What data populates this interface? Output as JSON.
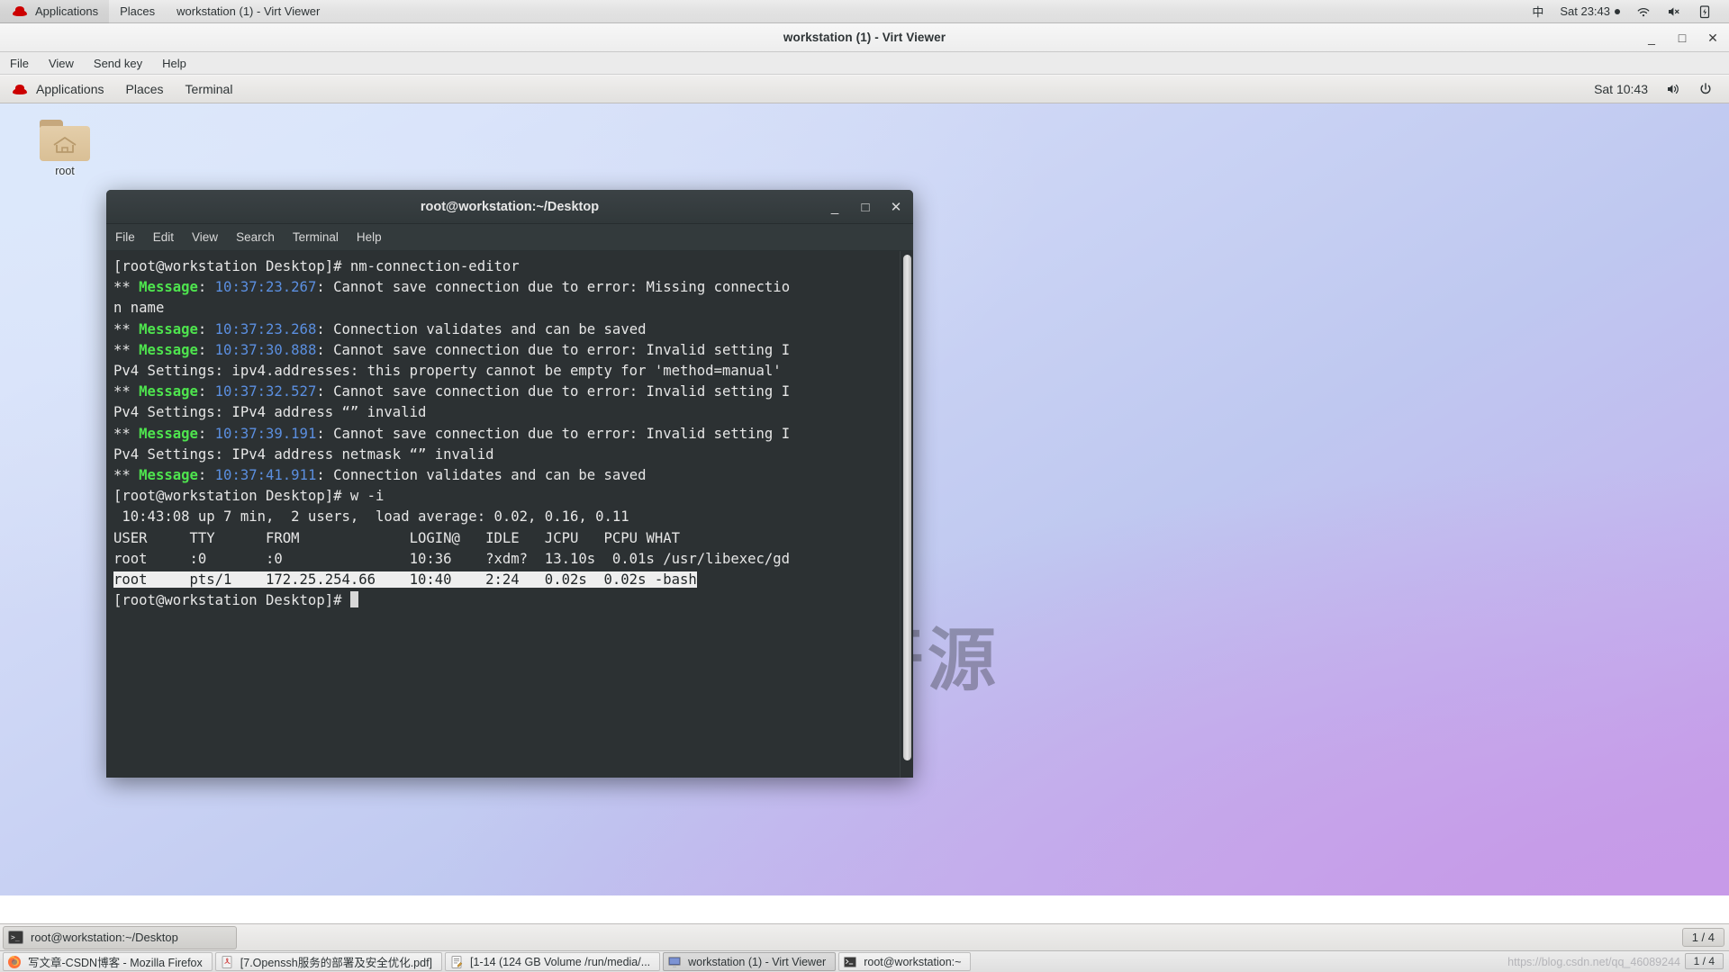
{
  "host_panel": {
    "applications": "Applications",
    "places": "Places",
    "active_window": "workstation (1) - Virt Viewer",
    "input_method": "中",
    "clock": "Sat 23:43",
    "wifi_icon": "wifi-icon",
    "volume_icon": "volume-muted-icon",
    "battery_icon": "battery-charging-icon"
  },
  "virt_viewer": {
    "title": "workstation (1) - Virt Viewer",
    "menus": [
      "File",
      "View",
      "Send key",
      "Help"
    ],
    "window_buttons": {
      "minimize": "_",
      "maximize": "□",
      "close": "✕"
    }
  },
  "guest_panel": {
    "applications": "Applications",
    "places": "Places",
    "active_app": "Terminal",
    "clock": "Sat 10:43",
    "volume_icon": "volume-icon",
    "power_icon": "power-icon"
  },
  "desktop": {
    "icon_label": "root",
    "icon_name": "home-folder-icon",
    "watermark": "西部开源"
  },
  "terminal": {
    "title": "root@workstation:~/Desktop",
    "menus": [
      "File",
      "Edit",
      "View",
      "Search",
      "Terminal",
      "Help"
    ],
    "window_buttons": {
      "minimize": "_",
      "maximize": "□",
      "close": "✕"
    },
    "prompt": "[root@workstation Desktop]# ",
    "lines": [
      {
        "type": "prompt",
        "prompt": "[root@workstation Desktop]# ",
        "command": "nm-connection-editor"
      },
      {
        "type": "message",
        "prefix": "** ",
        "tag": "Message",
        "sep": ": ",
        "time": "10:37:23.267",
        "text": ": Cannot save connection due to error: Missing connectio"
      },
      {
        "type": "plain",
        "text": "n name"
      },
      {
        "type": "message",
        "prefix": "** ",
        "tag": "Message",
        "sep": ": ",
        "time": "10:37:23.268",
        "text": ": Connection validates and can be saved"
      },
      {
        "type": "message",
        "prefix": "** ",
        "tag": "Message",
        "sep": ": ",
        "time": "10:37:30.888",
        "text": ": Cannot save connection due to error: Invalid setting I"
      },
      {
        "type": "plain",
        "text": "Pv4 Settings: ipv4.addresses: this property cannot be empty for 'method=manual'"
      },
      {
        "type": "message",
        "prefix": "** ",
        "tag": "Message",
        "sep": ": ",
        "time": "10:37:32.527",
        "text": ": Cannot save connection due to error: Invalid setting I"
      },
      {
        "type": "plain",
        "text": "Pv4 Settings: IPv4 address “” invalid"
      },
      {
        "type": "message",
        "prefix": "** ",
        "tag": "Message",
        "sep": ": ",
        "time": "10:37:39.191",
        "text": ": Cannot save connection due to error: Invalid setting I"
      },
      {
        "type": "plain",
        "text": "Pv4 Settings: IPv4 address netmask “” invalid"
      },
      {
        "type": "message",
        "prefix": "** ",
        "tag": "Message",
        "sep": ": ",
        "time": "10:37:41.911",
        "text": ": Connection validates and can be saved"
      },
      {
        "type": "prompt",
        "prompt": "[root@workstation Desktop]# ",
        "command": "w -i"
      },
      {
        "type": "plain",
        "text": " 10:43:08 up 7 min,  2 users,  load average: 0.02, 0.16, 0.11"
      },
      {
        "type": "plain",
        "text": "USER     TTY      FROM             LOGIN@   IDLE   JCPU   PCPU WHAT"
      },
      {
        "type": "plain",
        "text": "root     :0       :0               10:36    ?xdm?  13.10s  0.01s /usr/libexec/gd"
      },
      {
        "type": "selected",
        "text": "root     pts/1    172.25.254.66    10:40    2:24   0.02s  0.02s -bash"
      },
      {
        "type": "cursor",
        "prompt": "[root@workstation Desktop]# "
      }
    ],
    "w_output": {
      "uptime": "10:43:08 up 7 min,  2 users,  load average: 0.02, 0.16, 0.11",
      "headers": [
        "USER",
        "TTY",
        "FROM",
        "LOGIN@",
        "IDLE",
        "JCPU",
        "PCPU",
        "WHAT"
      ],
      "rows": [
        {
          "user": "root",
          "tty": ":0",
          "from": ":0",
          "login": "10:36",
          "idle": "?xdm?",
          "jcpu": "13.10s",
          "pcpu": "0.01s",
          "what": "/usr/libexec/gd",
          "selected": false
        },
        {
          "user": "root",
          "tty": "pts/1",
          "from": "172.25.254.66",
          "login": "10:40",
          "idle": "2:24",
          "jcpu": "0.02s",
          "pcpu": "0.02s",
          "what": "-bash",
          "selected": true
        }
      ]
    },
    "colors": {
      "background": "#2c3133",
      "text": "#e6e6e6",
      "green": "#4ee44e",
      "blue": "#5b8fe0",
      "selection_bg": "#eeeeee"
    }
  },
  "guest_taskbar": {
    "window_button": "root@workstation:~/Desktop",
    "workspace": "1 / 4"
  },
  "host_taskbar": {
    "items": [
      {
        "label": "写文章-CSDN博客 - Mozilla Firefox",
        "icon": "firefox-icon",
        "active": false
      },
      {
        "label": "[7.Openssh服务的部署及安全优化.pdf]",
        "icon": "pdf-icon",
        "active": false
      },
      {
        "label": "[1-14 (124 GB Volume /run/media/...",
        "icon": "document-icon",
        "active": false
      },
      {
        "label": "workstation (1) - Virt Viewer",
        "icon": "display-icon",
        "active": true
      },
      {
        "label": "root@workstation:~",
        "icon": "terminal-icon",
        "active": false
      }
    ],
    "watermark": "https://blog.csdn.net/qq_46089244",
    "workspace": "1 / 4"
  }
}
